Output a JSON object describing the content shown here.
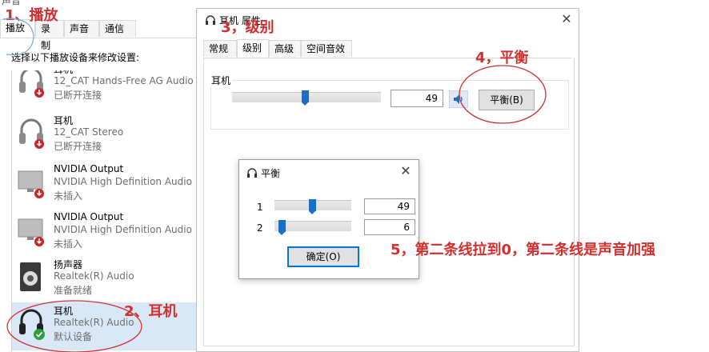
{
  "sound": {
    "title": "声音",
    "tabs": [
      "播放",
      "录制",
      "声音",
      "通信"
    ],
    "prompt": "选择以下播放设备来修改设置:",
    "devices": [
      {
        "name": "耳机",
        "desc": "12_CAT Hands-Free AG Audio",
        "status": "已断开连接",
        "icon": "headphones-icon",
        "badge": "disconnected-badge-icon"
      },
      {
        "name": "耳机",
        "desc": "12_CAT Stereo",
        "status": "已断开连接",
        "icon": "headphones-icon",
        "badge": "disconnected-badge-icon"
      },
      {
        "name": "NVIDIA Output",
        "desc": "NVIDIA High Definition Audio",
        "status": "未插入",
        "icon": "monitor-icon",
        "badge": "unplugged-badge-icon"
      },
      {
        "name": "NVIDIA Output",
        "desc": "NVIDIA High Definition Audio",
        "status": "未插入",
        "icon": "monitor-icon",
        "badge": "unplugged-badge-icon"
      },
      {
        "name": "扬声器",
        "desc": "Realtek(R) Audio",
        "status": "准备就绪",
        "icon": "speaker-icon",
        "badge": ""
      },
      {
        "name": "耳机",
        "desc": "Realtek(R) Audio",
        "status": "默认设备",
        "icon": "headphones-icon",
        "badge": "default-check-icon"
      }
    ]
  },
  "properties": {
    "title": "耳机 属性",
    "close": "✕",
    "tabs": [
      "常规",
      "级别",
      "高级",
      "空间音效"
    ],
    "active_tab": "级别",
    "level_label": "耳机",
    "level_value": "49",
    "level_fraction": 0.49,
    "balance_button": "平衡(B)"
  },
  "balance": {
    "title": "平衡",
    "close": "✕",
    "channels": [
      {
        "label": "1",
        "value": "49",
        "fraction": 0.49
      },
      {
        "label": "2",
        "value": "6",
        "fraction": 0.06
      }
    ],
    "ok_button": "确定(O)"
  },
  "annotations": {
    "a1": "1、播放",
    "a2": "2、耳机",
    "a3": "3，级别",
    "a4": "4，平衡",
    "a5": "5，第二条线拉到0，第二条线是声音加强"
  },
  "colors": {
    "annotation": "#d32f2f",
    "accent": "#1a6fc9",
    "default_badge": "#2e9e3e",
    "disconnected_badge": "#c62828"
  }
}
